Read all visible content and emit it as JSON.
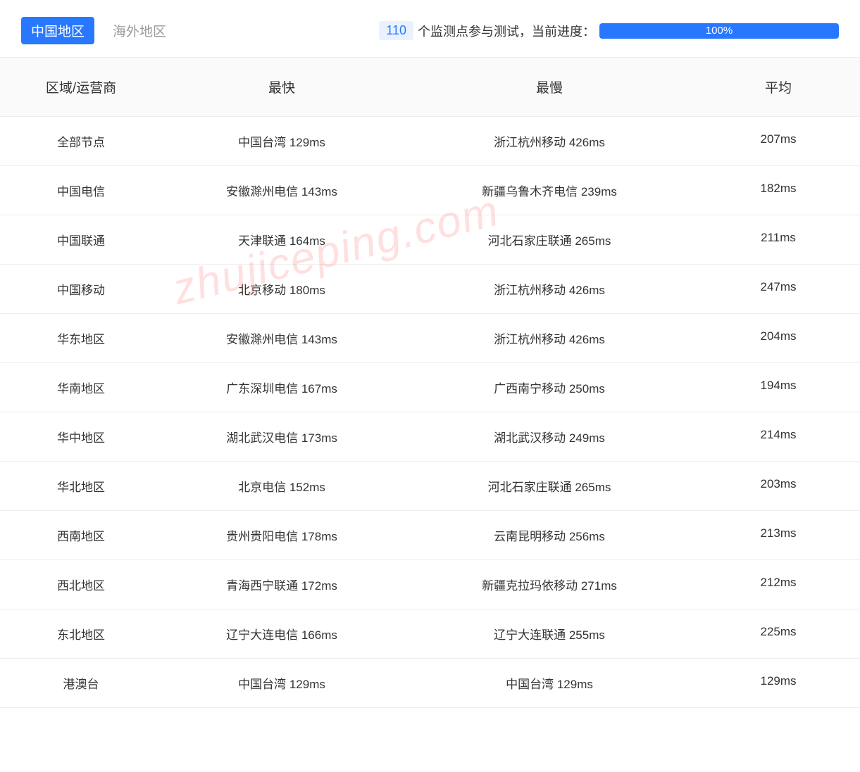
{
  "watermark": "zhujiceping.com",
  "tabs": {
    "active": "中国地区",
    "inactive": "海外地区"
  },
  "progress": {
    "count": "110",
    "label": "个监测点参与测试，当前进度：",
    "percent": "100%"
  },
  "table": {
    "headers": {
      "region": "区域/运营商",
      "fastest": "最快",
      "slowest": "最慢",
      "avg": "平均"
    },
    "rows": [
      {
        "region": "全部节点",
        "fastest": "中国台湾 129ms",
        "slowest": "浙江杭州移动 426ms",
        "avg": "207ms"
      },
      {
        "region": "中国电信",
        "fastest": "安徽滁州电信 143ms",
        "slowest": "新疆乌鲁木齐电信 239ms",
        "avg": "182ms"
      },
      {
        "region": "中国联通",
        "fastest": "天津联通 164ms",
        "slowest": "河北石家庄联通 265ms",
        "avg": "211ms"
      },
      {
        "region": "中国移动",
        "fastest": "北京移动 180ms",
        "slowest": "浙江杭州移动 426ms",
        "avg": "247ms"
      },
      {
        "region": "华东地区",
        "fastest": "安徽滁州电信 143ms",
        "slowest": "浙江杭州移动 426ms",
        "avg": "204ms"
      },
      {
        "region": "华南地区",
        "fastest": "广东深圳电信 167ms",
        "slowest": "广西南宁移动 250ms",
        "avg": "194ms"
      },
      {
        "region": "华中地区",
        "fastest": "湖北武汉电信 173ms",
        "slowest": "湖北武汉移动 249ms",
        "avg": "214ms"
      },
      {
        "region": "华北地区",
        "fastest": "北京电信 152ms",
        "slowest": "河北石家庄联通 265ms",
        "avg": "203ms"
      },
      {
        "region": "西南地区",
        "fastest": "贵州贵阳电信 178ms",
        "slowest": "云南昆明移动 256ms",
        "avg": "213ms"
      },
      {
        "region": "西北地区",
        "fastest": "青海西宁联通 172ms",
        "slowest": "新疆克拉玛依移动 271ms",
        "avg": "212ms"
      },
      {
        "region": "东北地区",
        "fastest": "辽宁大连电信 166ms",
        "slowest": "辽宁大连联通 255ms",
        "avg": "225ms"
      },
      {
        "region": "港澳台",
        "fastest": "中国台湾 129ms",
        "slowest": "中国台湾 129ms",
        "avg": "129ms"
      }
    ]
  }
}
